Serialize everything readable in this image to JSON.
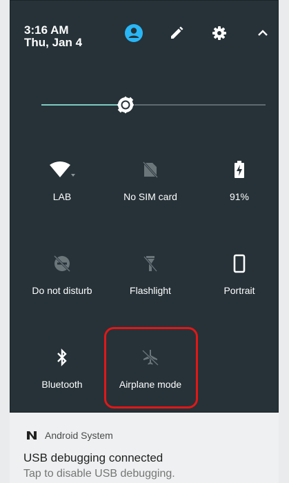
{
  "status": {
    "time": "3:16 AM",
    "date": "Thu, Jan 4"
  },
  "header_icons": [
    "account-icon",
    "edit-icon",
    "settings-icon",
    "collapse-chevron-icon"
  ],
  "brightness": {
    "level": 0.35,
    "accent": "#80cbc4"
  },
  "tiles": [
    {
      "label": "LAB",
      "icon": "wifi-icon",
      "state": "on"
    },
    {
      "label": "No SIM card",
      "icon": "no-sim-icon",
      "state": "off"
    },
    {
      "label": "91%",
      "icon": "battery-charging-icon",
      "state": "on"
    },
    {
      "label": "Do not disturb",
      "icon": "do-not-disturb-off-icon",
      "state": "off"
    },
    {
      "label": "Flashlight",
      "icon": "flashlight-icon",
      "state": "off"
    },
    {
      "label": "Portrait",
      "icon": "portrait-icon",
      "state": "on"
    },
    {
      "label": "Bluetooth",
      "icon": "bluetooth-icon",
      "state": "on"
    },
    {
      "label": "Airplane mode",
      "icon": "airplane-icon",
      "state": "off"
    }
  ],
  "notification": {
    "app_name": "Android System",
    "title": "USB debugging connected",
    "text": "Tap to disable USB debugging."
  },
  "colors": {
    "shade_bg": "#263238",
    "account_icon": "#29b6f6",
    "highlight": "#e21717"
  }
}
